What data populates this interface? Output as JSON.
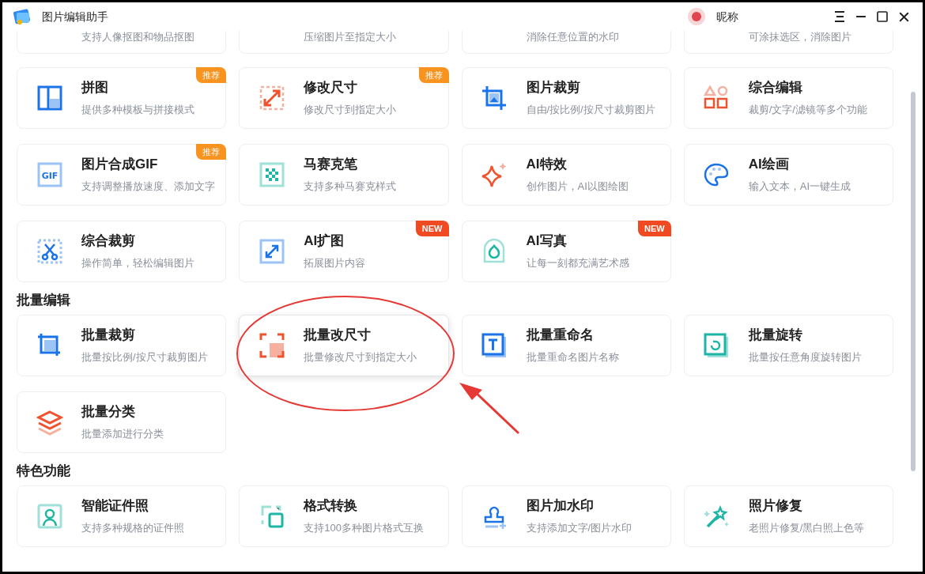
{
  "window": {
    "title": "图片编辑助手"
  },
  "user": {
    "name": "昵称"
  },
  "partial_row": [
    {
      "description": "支持人像抠图和物品抠图"
    },
    {
      "description": "压缩图片至指定大小"
    },
    {
      "description": "消除任意位置的水印"
    },
    {
      "description": "可涂抹选区，消除图片"
    }
  ],
  "tools": [
    {
      "title": "拼图",
      "description": "提供多种模板与拼接模式",
      "badge": {
        "kind": "recommend",
        "text": "推荐"
      }
    },
    {
      "title": "修改尺寸",
      "description": "修改尺寸到指定大小",
      "badge": {
        "kind": "recommend",
        "text": "推荐"
      }
    },
    {
      "title": "图片裁剪",
      "description": "自由/按比例/按尺寸裁剪图片"
    },
    {
      "title": "综合编辑",
      "description": "裁剪/文字/滤镜等多个功能"
    },
    {
      "title": "图片合成GIF",
      "description": "支持调整播放速度、添加文字",
      "badge": {
        "kind": "recommend",
        "text": "推荐"
      },
      "icon_text": "GIF"
    },
    {
      "title": "马赛克笔",
      "description": "支持多种马赛克样式"
    },
    {
      "title": "AI特效",
      "description": "创作图片，AI以图绘图"
    },
    {
      "title": "AI绘画",
      "description": "输入文本，AI一键生成"
    },
    {
      "title": "综合裁剪",
      "description": "操作简单，轻松编辑图片"
    },
    {
      "title": "AI扩图",
      "description": "拓展图片内容",
      "badge": {
        "kind": "new",
        "text": "NEW"
      }
    },
    {
      "title": "AI写真",
      "description": "让每一刻都充满艺术感",
      "badge": {
        "kind": "new",
        "text": "NEW"
      }
    }
  ],
  "sections": [
    {
      "heading": "批量编辑",
      "tools": [
        {
          "title": "批量裁剪",
          "description": "批量按比例/按尺寸裁剪图片"
        },
        {
          "title": "批量改尺寸",
          "description": "批量修改尺寸到指定大小",
          "hovered": true
        },
        {
          "title": "批量重命名",
          "description": "批量重命名图片名称"
        },
        {
          "title": "批量旋转",
          "description": "批量按任意角度旋转图片"
        },
        {
          "title": "批量分类",
          "description": "批量添加进行分类"
        }
      ]
    },
    {
      "heading": "特色功能",
      "tools": [
        {
          "title": "智能证件照",
          "description": "支持多种规格的证件照"
        },
        {
          "title": "格式转换",
          "description": "支持100多种图片格式互换"
        },
        {
          "title": "图片加水印",
          "description": "支持添加文字/图片水印"
        },
        {
          "title": "照片修复",
          "description": "老照片修复/黑白照上色等"
        }
      ]
    }
  ]
}
